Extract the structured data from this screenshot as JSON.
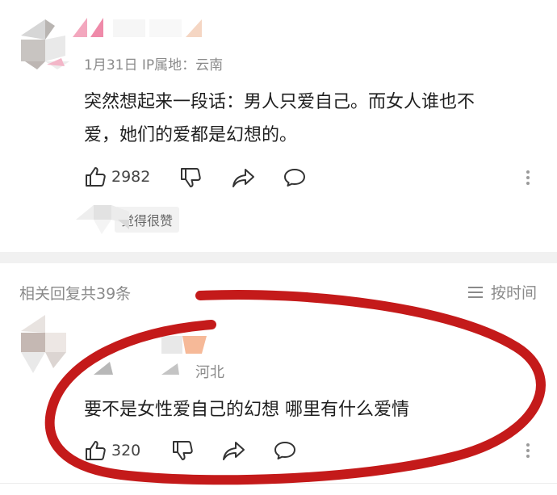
{
  "comment": {
    "date_location": "1月31日 IP属地：云南",
    "text_line1": "突然想起来一段话：男人只爱自己。而女人谁也不",
    "text_line2": "爱，她们的爱都是幻想的。",
    "like_count": "2982",
    "chip": "觉得很赞"
  },
  "replies_header": {
    "count_label": "相关回复共39条",
    "sort_label": "按时间"
  },
  "reply": {
    "location_fragment": "河北",
    "text": "要不是女性爱自己的幻想  哪里有什么爱情",
    "like_count": "320"
  },
  "annotation": {
    "ellipse_color": "#c41a1a"
  }
}
